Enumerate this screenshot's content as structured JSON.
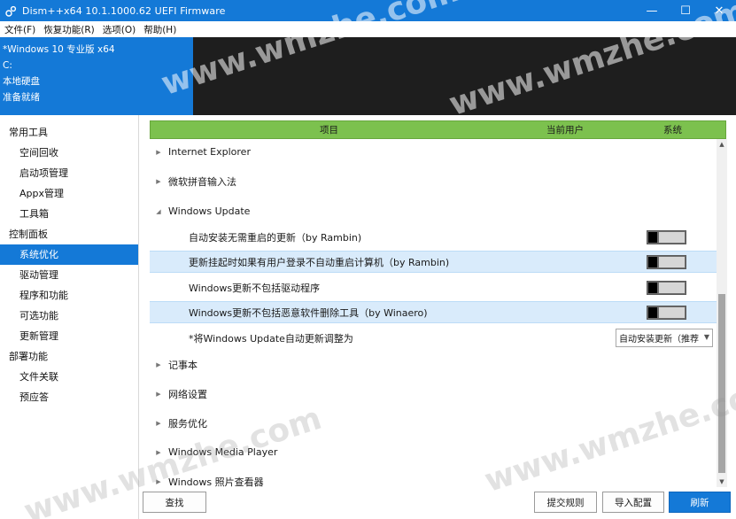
{
  "window": {
    "title": "Dism++x64 10.1.1000.62 UEFI Firmware",
    "minimize": "—",
    "maximize": "☐",
    "close": "✕"
  },
  "menu": [
    "文件(F)",
    "恢复功能(R)",
    "选项(O)",
    "帮助(H)"
  ],
  "image_info": {
    "name": "*Windows 10 专业版 x64",
    "drive": "C:",
    "disk": "本地硬盘",
    "status": "准备就绪"
  },
  "sidebar": {
    "groups": [
      {
        "label": "常用工具",
        "items": [
          "空间回收",
          "启动项管理",
          "Appx管理",
          "工具箱"
        ]
      },
      {
        "label": "控制面板",
        "items": [
          "系统优化",
          "驱动管理",
          "程序和功能",
          "可选功能",
          "更新管理"
        ]
      },
      {
        "label": "部署功能",
        "items": [
          "文件关联",
          "预应答"
        ]
      }
    ],
    "active_item": "系统优化"
  },
  "table": {
    "columns": {
      "item": "项目",
      "user": "当前用户",
      "system": "系统"
    },
    "rows": [
      {
        "type": "category",
        "label": "Internet Explorer",
        "expanded": false
      },
      {
        "type": "category",
        "label": "微软拼音输入法",
        "expanded": false
      },
      {
        "type": "category",
        "label": "Windows Update",
        "expanded": true
      },
      {
        "type": "toggle",
        "label": "自动安装无需重启的更新（by Rambin)",
        "state": "off",
        "selected": false
      },
      {
        "type": "toggle",
        "label": "更新挂起时如果有用户登录不自动重启计算机（by Rambin)",
        "state": "off",
        "selected": true
      },
      {
        "type": "toggle",
        "label": "Windows更新不包括驱动程序",
        "state": "off",
        "selected": false
      },
      {
        "type": "toggle",
        "label": "Windows更新不包括恶意软件删除工具（by Winaero)",
        "state": "off",
        "selected": true
      },
      {
        "type": "select",
        "label": "*将Windows Update自动更新调整为",
        "value": "自动安装更新（推荐",
        "selected": false
      },
      {
        "type": "category",
        "label": "记事本",
        "expanded": false
      },
      {
        "type": "category",
        "label": "网络设置",
        "expanded": false
      },
      {
        "type": "category",
        "label": "服务优化",
        "expanded": false
      },
      {
        "type": "category",
        "label": "Windows Media Player",
        "expanded": false
      },
      {
        "type": "category",
        "label": "Windows 照片查看器",
        "expanded": false
      }
    ]
  },
  "buttons": {
    "find": "查找",
    "submit_rules": "提交规则",
    "import_config": "导入配置",
    "refresh": "刷新"
  },
  "watermark": "www.wmzhe.com",
  "colors": {
    "accent": "#1479d7",
    "header_green": "#7cc14e",
    "selected_row": "#d9ebfb",
    "header_dark": "#1e1e1e"
  }
}
